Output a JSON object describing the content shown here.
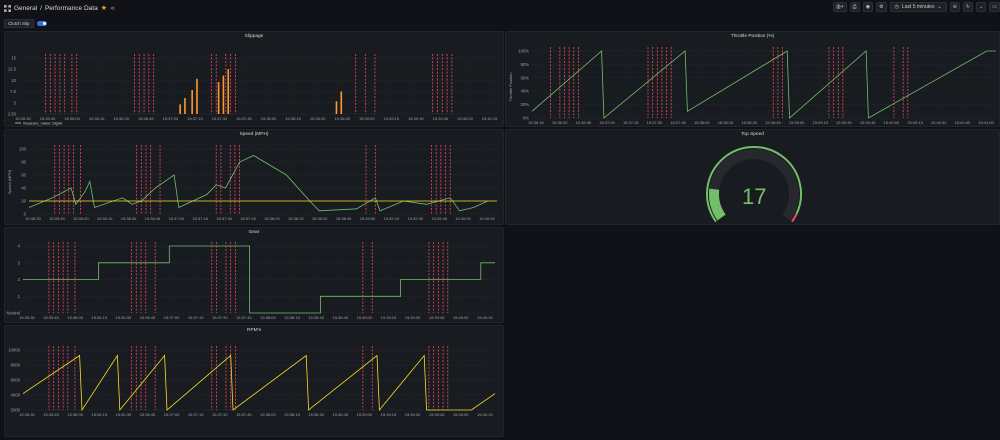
{
  "breadcrumb": {
    "folder": "General",
    "separator": "/",
    "dashboard": "Performance Data"
  },
  "toolbar": {
    "time_range": "Last 5 minutes"
  },
  "variable": {
    "label": "Clutch Slip",
    "enabled": true
  },
  "colors": {
    "green": "#73bf69",
    "yellow": "#fade2a",
    "red": "#f2495c",
    "orange": "#ff9830",
    "annotation": "#f2495c"
  },
  "panels": {
    "slippage": {
      "title": "Slippage",
      "legend": "measure_value::bigint"
    },
    "throttle": {
      "title": "Throttle Position (%)",
      "ylabel": "Throttle Position"
    },
    "speed": {
      "title": "Speed (MPH)",
      "ylabel": "Speed (MPH)"
    },
    "top_speed": {
      "title": "Top Speed",
      "value": "17"
    },
    "gear": {
      "title": "Gear"
    },
    "rpm": {
      "title": "RPM's"
    }
  },
  "chart_data": [
    {
      "name": "slippage",
      "type": "bar",
      "y_ticks": [
        "15",
        "12.5",
        "10",
        "7.5",
        "5",
        "2.50"
      ],
      "x_ticks": [
        "15:35:30",
        "15:35:45",
        "15:36:00",
        "15:36:15",
        "15:36:30",
        "15:36:45",
        "15:37:00",
        "15:37:15",
        "15:37:30",
        "15:37:45",
        "15:38:00",
        "15:38:15",
        "15:38:30",
        "15:38:45",
        "15:39:00",
        "15:39:15",
        "15:39:30",
        "15:39:45",
        "15:40:00",
        "15:40:15"
      ],
      "ylim": [
        0,
        17.5
      ],
      "bars": [
        {
          "t": 0.335,
          "v": 3
        },
        {
          "t": 0.345,
          "v": 5
        },
        {
          "t": 0.36,
          "v": 7.5
        },
        {
          "t": 0.37,
          "v": 11
        },
        {
          "t": 0.415,
          "v": 10
        },
        {
          "t": 0.425,
          "v": 12
        },
        {
          "t": 0.435,
          "v": 14
        },
        {
          "t": 0.66,
          "v": 4
        },
        {
          "t": 0.67,
          "v": 7
        }
      ],
      "annotations": [
        0.055,
        0.065,
        0.075,
        0.085,
        0.095,
        0.11,
        0.12,
        0.24,
        0.25,
        0.26,
        0.27,
        0.28,
        0.4,
        0.41,
        0.43,
        0.44,
        0.45,
        0.7,
        0.72,
        0.74,
        0.86,
        0.87,
        0.88,
        0.89,
        0.9
      ]
    },
    {
      "name": "throttle",
      "type": "line",
      "y_ticks": [
        "100%",
        "80%",
        "60%",
        "40%",
        "20%",
        "0%"
      ],
      "x_ticks": [
        "15:36:15",
        "15:36:30",
        "15:36:45",
        "15:37:00",
        "15:37:15",
        "15:37:30",
        "15:37:45",
        "15:38:00",
        "15:38:15",
        "15:38:30",
        "15:38:45",
        "15:39:00",
        "15:39:15",
        "15:39:30",
        "15:39:45",
        "15:40:00",
        "15:40:15",
        "15:40:30",
        "15:40:45",
        "15:41:00"
      ],
      "ylim": [
        0,
        100
      ],
      "points": [
        [
          0,
          10
        ],
        [
          0.15,
          100
        ],
        [
          0.155,
          0
        ],
        [
          0.33,
          100
        ],
        [
          0.335,
          10
        ],
        [
          0.55,
          100
        ],
        [
          0.555,
          0
        ],
        [
          0.72,
          100
        ],
        [
          0.725,
          0
        ],
        [
          0.98,
          100
        ],
        [
          1,
          100
        ]
      ],
      "annotations": [
        0.04,
        0.06,
        0.07,
        0.08,
        0.09,
        0.1,
        0.25,
        0.26,
        0.27,
        0.28,
        0.29,
        0.3,
        0.52,
        0.53,
        0.54,
        0.64,
        0.65,
        0.66,
        0.67,
        0.78,
        0.8,
        0.81
      ]
    },
    {
      "name": "speed",
      "type": "line",
      "y_ticks": [
        "100",
        "80",
        "60",
        "40",
        "20",
        "0"
      ],
      "x_ticks": [
        "15:35:30",
        "15:35:45",
        "15:36:00",
        "15:36:15",
        "15:36:30",
        "15:36:45",
        "15:37:00",
        "15:37:15",
        "15:37:30",
        "15:37:45",
        "15:38:00",
        "15:38:15",
        "15:38:30",
        "15:38:45",
        "15:39:00",
        "15:39:15",
        "15:39:30",
        "15:39:45",
        "15:40:00",
        "15:40:15"
      ],
      "ylim": [
        0,
        100
      ],
      "series": [
        {
          "color": "green",
          "points": [
            [
              0,
              10
            ],
            [
              0.05,
              25
            ],
            [
              0.09,
              40
            ],
            [
              0.1,
              15
            ],
            [
              0.12,
              35
            ],
            [
              0.13,
              50
            ],
            [
              0.14,
              10
            ],
            [
              0.2,
              25
            ],
            [
              0.22,
              15
            ],
            [
              0.24,
              20
            ],
            [
              0.27,
              40
            ],
            [
              0.3,
              55
            ],
            [
              0.31,
              60
            ],
            [
              0.32,
              10
            ],
            [
              0.38,
              30
            ],
            [
              0.4,
              45
            ],
            [
              0.42,
              40
            ],
            [
              0.45,
              80
            ],
            [
              0.48,
              90
            ],
            [
              0.55,
              60
            ],
            [
              0.6,
              20
            ],
            [
              0.62,
              5
            ],
            [
              0.7,
              8
            ],
            [
              0.74,
              25
            ],
            [
              0.75,
              5
            ],
            [
              0.8,
              20
            ],
            [
              0.85,
              15
            ],
            [
              0.9,
              25
            ],
            [
              0.92,
              5
            ],
            [
              0.95,
              10
            ],
            [
              0.98,
              20
            ]
          ]
        },
        {
          "color": "yellow",
          "points": [
            [
              0,
              20
            ],
            [
              1,
              20
            ]
          ]
        }
      ],
      "annotations": [
        0.055,
        0.065,
        0.075,
        0.085,
        0.095,
        0.11,
        0.23,
        0.24,
        0.25,
        0.26,
        0.28,
        0.4,
        0.41,
        0.43,
        0.44,
        0.45,
        0.72,
        0.74,
        0.86,
        0.87,
        0.88,
        0.89,
        0.9
      ]
    },
    {
      "name": "gear",
      "type": "line",
      "y_ticks": [
        "4",
        "3",
        "2",
        "1",
        "Neutral"
      ],
      "x_ticks": [
        "15:35:30",
        "15:35:45",
        "15:36:00",
        "15:36:15",
        "15:36:30",
        "15:36:45",
        "15:37:00",
        "15:37:15",
        "15:37:30",
        "15:37:45",
        "15:38:00",
        "15:38:15",
        "15:38:30",
        "15:38:45",
        "15:39:00",
        "15:39:15",
        "15:39:30",
        "15:39:45",
        "15:40:00",
        "15:40:15"
      ],
      "ylim": [
        0,
        4
      ],
      "points": [
        [
          0,
          2
        ],
        [
          0.16,
          2
        ],
        [
          0.16,
          3
        ],
        [
          0.31,
          3
        ],
        [
          0.31,
          4
        ],
        [
          0.48,
          4
        ],
        [
          0.48,
          0
        ],
        [
          0.63,
          0
        ],
        [
          0.63,
          1
        ],
        [
          0.8,
          1
        ],
        [
          0.8,
          2
        ],
        [
          0.97,
          2
        ],
        [
          0.97,
          3
        ],
        [
          1,
          3
        ]
      ],
      "annotations": [
        0.055,
        0.065,
        0.075,
        0.085,
        0.095,
        0.11,
        0.23,
        0.24,
        0.25,
        0.26,
        0.28,
        0.4,
        0.41,
        0.43,
        0.44,
        0.45,
        0.72,
        0.74,
        0.86,
        0.87,
        0.88,
        0.89,
        0.9
      ]
    },
    {
      "name": "rpm",
      "type": "line",
      "y_ticks": [
        "10000",
        "8000",
        "6000",
        "4000",
        "2000"
      ],
      "x_ticks": [
        "15:35:30",
        "15:35:45",
        "15:36:00",
        "15:36:15",
        "15:36:30",
        "15:36:45",
        "15:37:00",
        "15:37:15",
        "15:37:30",
        "15:37:45",
        "15:38:00",
        "15:38:15",
        "15:38:30",
        "15:38:45",
        "15:39:00",
        "15:39:15",
        "15:39:30",
        "15:39:45",
        "15:40:00",
        "15:40:15"
      ],
      "ylim": [
        0,
        11000
      ],
      "points": [
        [
          0,
          3000
        ],
        [
          0.12,
          10000
        ],
        [
          0.125,
          0
        ],
        [
          0.2,
          10000
        ],
        [
          0.205,
          0
        ],
        [
          0.3,
          10000
        ],
        [
          0.305,
          0
        ],
        [
          0.44,
          10000
        ],
        [
          0.445,
          0
        ],
        [
          0.6,
          10000
        ],
        [
          0.605,
          0
        ],
        [
          0.75,
          10000
        ],
        [
          0.755,
          0
        ],
        [
          0.85,
          10000
        ],
        [
          0.855,
          0
        ],
        [
          0.95,
          0
        ],
        [
          1,
          3000
        ]
      ],
      "annotations": [
        0.055,
        0.065,
        0.075,
        0.085,
        0.095,
        0.11,
        0.23,
        0.24,
        0.25,
        0.26,
        0.28,
        0.4,
        0.41,
        0.43,
        0.44,
        0.45,
        0.72,
        0.74,
        0.86,
        0.87,
        0.88,
        0.89,
        0.9
      ]
    },
    {
      "name": "top_speed",
      "type": "gauge",
      "value": 17,
      "min": 0,
      "max": 100,
      "thresholds": [
        {
          "color": "green",
          "from": 0
        },
        {
          "color": "red",
          "from": 96
        }
      ]
    }
  ]
}
